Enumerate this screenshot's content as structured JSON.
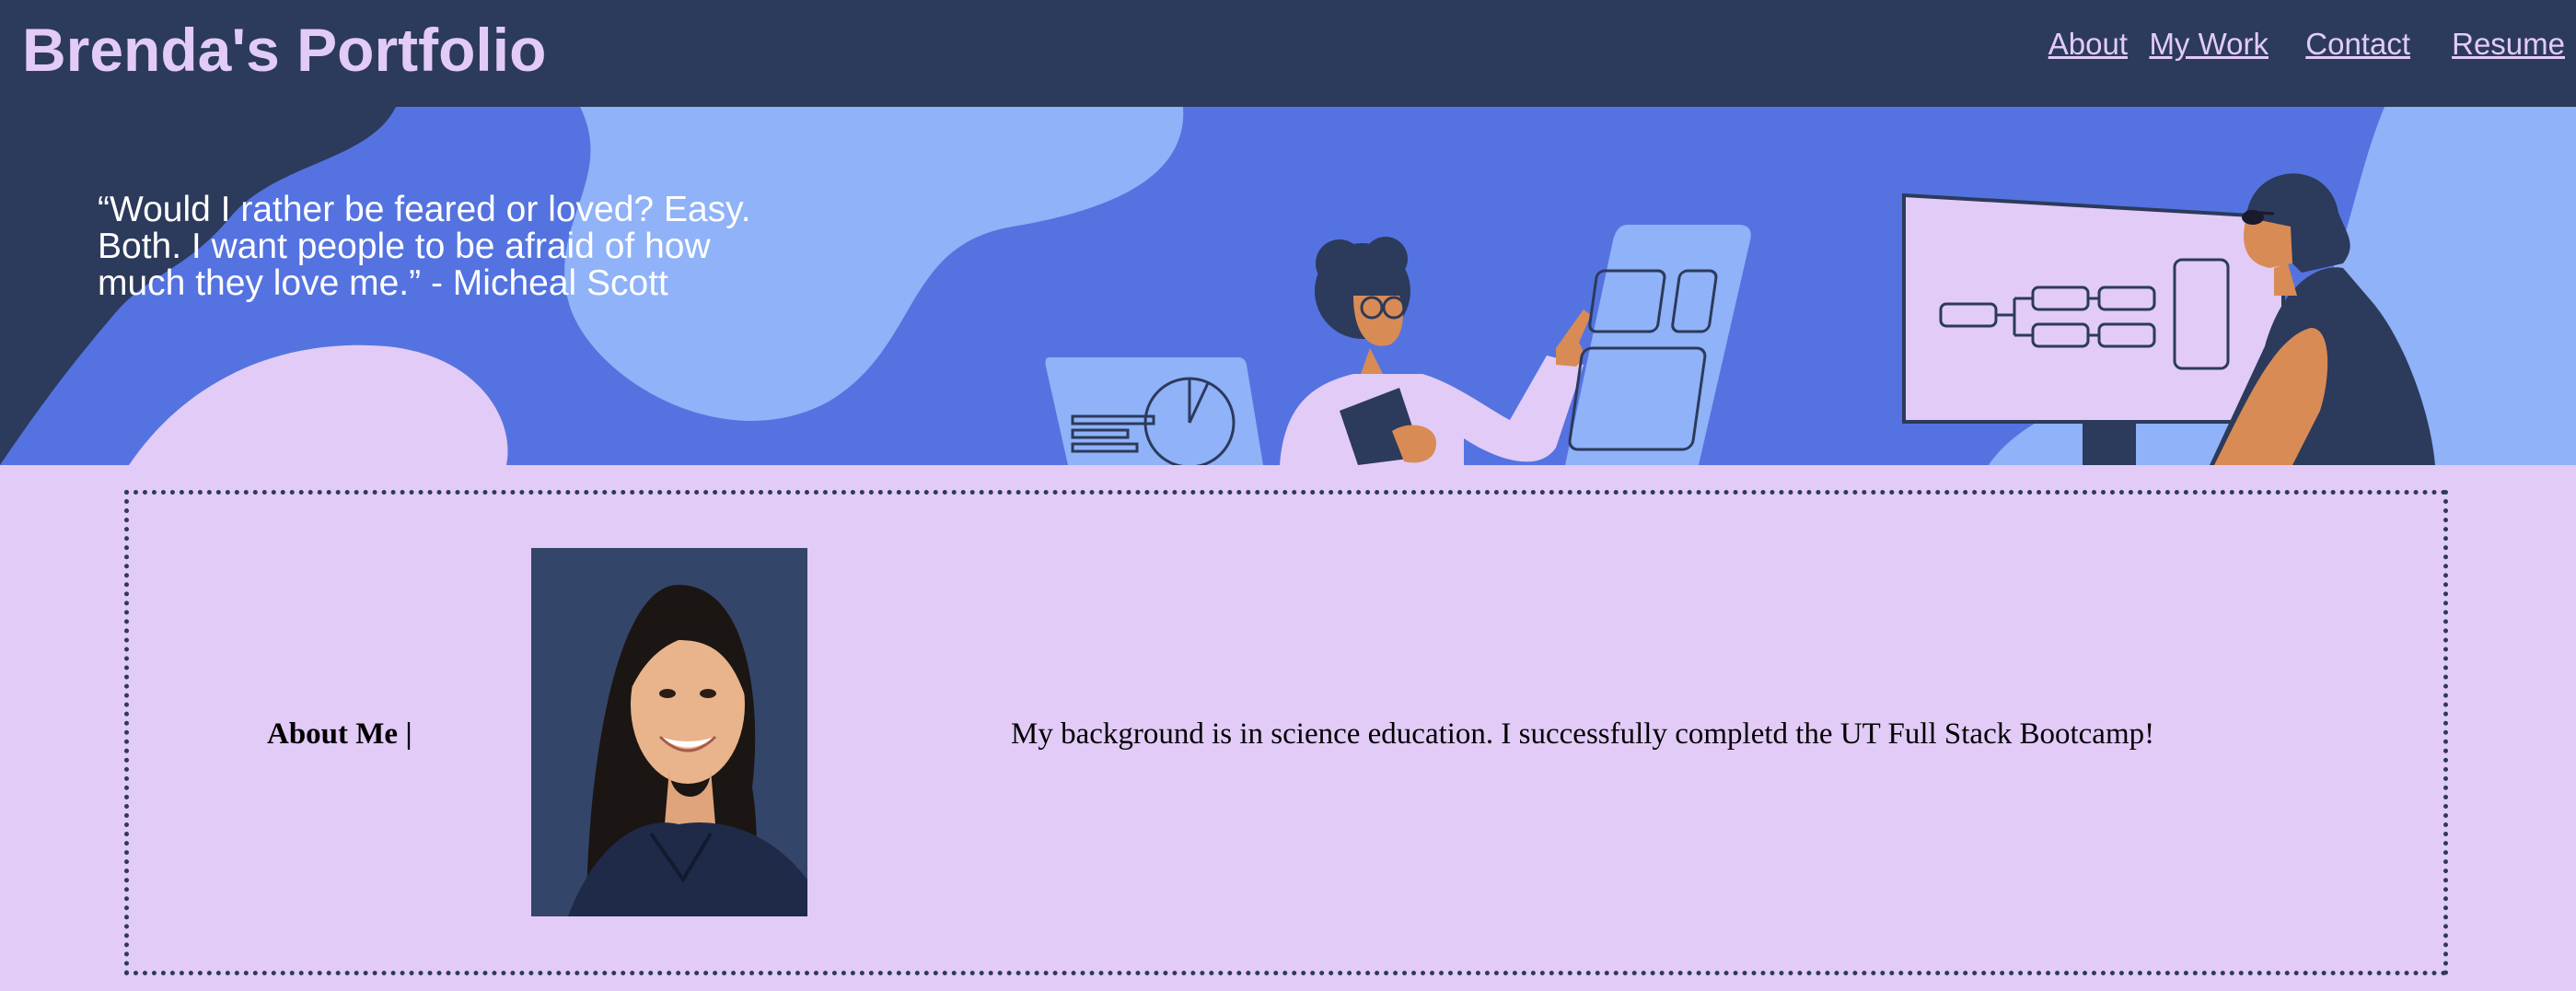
{
  "header": {
    "title": "Brenda's Portfolio",
    "nav": [
      "About",
      "My Work",
      "Contact",
      "Resume"
    ]
  },
  "hero": {
    "quote": "“Would I rather be feared or loved? Easy. Both. I want people to be afraid of how much they love me.” - Micheal Scott"
  },
  "about": {
    "heading": "About Me |",
    "text": "My background is in science education. I successfully completd the UT Full Stack Bootcamp!"
  },
  "colors": {
    "header_bg": "#2c3a5b",
    "accent_lavender": "#e2cbf7",
    "hero_blue": "#5473e0",
    "hero_light_blue": "#8fb2f8"
  }
}
